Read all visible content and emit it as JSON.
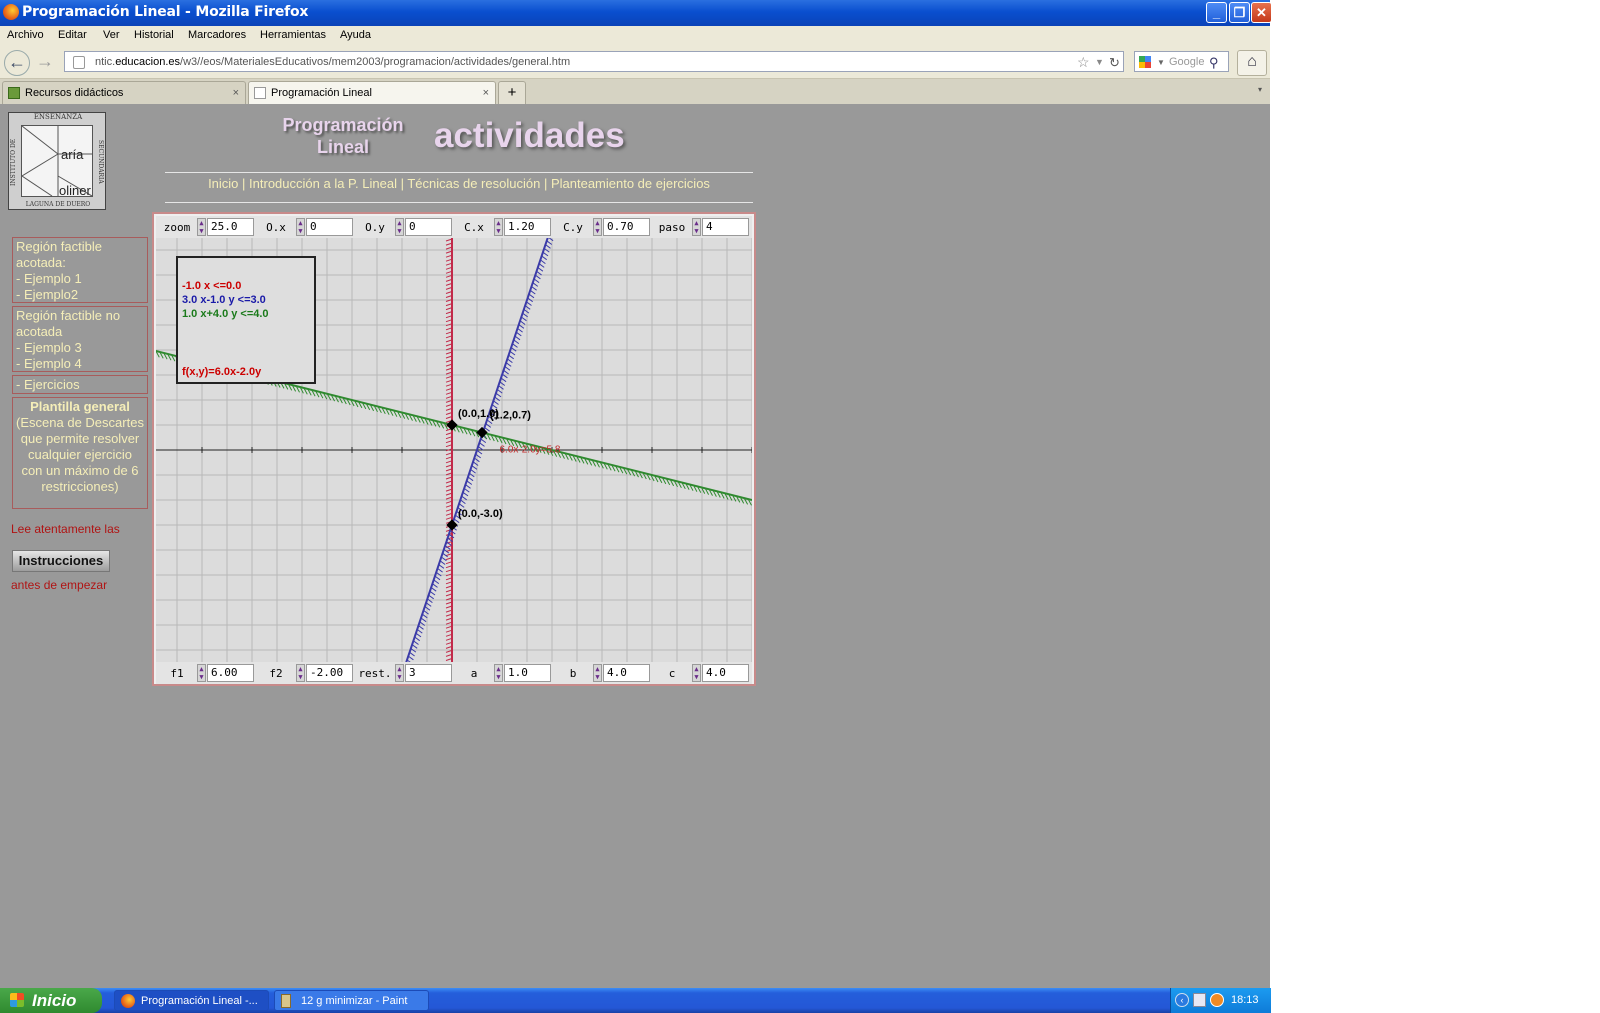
{
  "window": {
    "title": "Programación Lineal - Mozilla Firefox"
  },
  "menu": [
    "Archivo",
    "Editar",
    "Ver",
    "Historial",
    "Marcadores",
    "Herramientas",
    "Ayuda"
  ],
  "address": {
    "prefix": "ntic.",
    "domain": "educacion.es",
    "path": "/w3//eos/MaterialesEducativos/mem2003/programacion/actividades/general.htm"
  },
  "search": {
    "placeholder": "Google"
  },
  "tabs": [
    {
      "label": "Recursos didácticos",
      "active": false
    },
    {
      "label": "Programación Lineal",
      "active": true
    }
  ],
  "logo": {
    "top": "ENSEÑANZA",
    "left": "INSTITUTO DE",
    "right": "SECUNDARIA",
    "bottom": "LAGUNA DE DUERO",
    "word1": "aría",
    "word2": "oliner"
  },
  "header": {
    "subtitle_line1": "Programación",
    "subtitle_line2": "Lineal",
    "title": "actividades"
  },
  "topnav": [
    {
      "label": "Inicio"
    },
    {
      "label": "Introducción a la P. Lineal"
    },
    {
      "label": "Técnicas de resolución"
    },
    {
      "label": "Planteamiento de ejercicios"
    }
  ],
  "sidebar": {
    "group1_title": "Región factible acotada:",
    "group1_items": [
      "- Ejemplo 1",
      "- Ejemplo2"
    ],
    "group2_title": "Región factible no acotada",
    "group2_items": [
      "- Ejemplo 3",
      "- Ejemplo 4"
    ],
    "ejercicios": "- Ejercicios",
    "plantilla_title": "Plantilla general",
    "plantilla_desc": "(Escena de Descartes que permite resolver cualquier ejercicio con un máximo de 6 restricciones)",
    "lee": "Lee atentamente las",
    "instrucciones": "Instrucciones",
    "antes": "antes de empezar"
  },
  "controls_top": [
    {
      "name": "zoom",
      "value": "25.0"
    },
    {
      "name": "O.x",
      "value": "0"
    },
    {
      "name": "O.y",
      "value": "0"
    },
    {
      "name": "C.x",
      "value": "1.20"
    },
    {
      "name": "C.y",
      "value": "0.70"
    },
    {
      "name": "paso",
      "value": "4"
    }
  ],
  "controls_bottom": [
    {
      "name": "f1",
      "value": "6.00"
    },
    {
      "name": "f2",
      "value": "-2.00"
    },
    {
      "name": "rest.",
      "value": "3"
    },
    {
      "name": "a",
      "value": "1.0"
    },
    {
      "name": "b",
      "value": "4.0"
    },
    {
      "name": "c",
      "value": "4.0"
    }
  ],
  "info_box": {
    "restrictions": [
      {
        "text": "-1.0 x <=0.0",
        "color": "#cc0000"
      },
      {
        "text": "3.0 x-1.0 y <=3.0",
        "color": "#1a1aa8"
      },
      {
        "text": "1.0 x+4.0 y <=4.0",
        "color": "#1a7a1a"
      }
    ],
    "objective": "f(x,y)=6.0x-2.0y",
    "objective_color": "#cc0000"
  },
  "plot": {
    "x_range": [
      -12,
      12
    ],
    "y_range": [
      -8.4,
      8.7
    ],
    "unit_label": "zoom 25.0",
    "constraint_colors": [
      "#c22a4a",
      "#3a3aa8",
      "#2f8a2f"
    ],
    "points": [
      {
        "x": 0.0,
        "y": 1.0,
        "label": "(0.0,1.0)"
      },
      {
        "x": 1.2,
        "y": 0.7,
        "label": "(1.2,0.7)"
      },
      {
        "x": 0.0,
        "y": -3.0,
        "label": "(0.0,-3.0)"
      }
    ],
    "objective_label": "6.0x-2.0y=5.8"
  },
  "taskbar": {
    "start": "Inicio",
    "items": [
      "Programación Lineal -...",
      "12 g minimizar - Paint"
    ],
    "clock": "18:13"
  }
}
